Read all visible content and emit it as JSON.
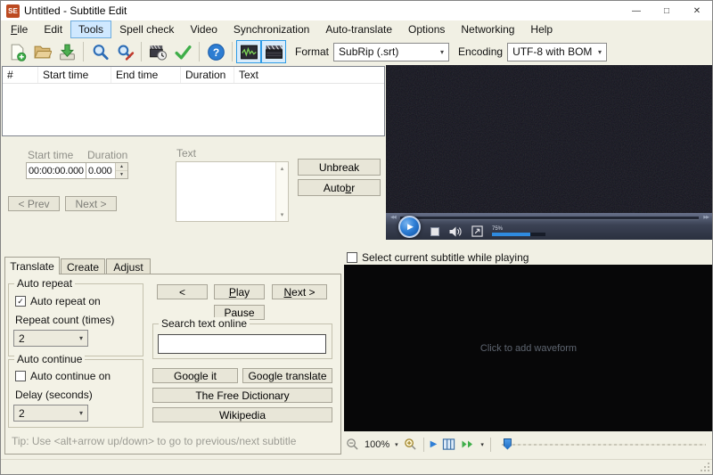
{
  "window": {
    "title": "Untitled - Subtitle Edit",
    "app_badge": "SE",
    "controls": {
      "minimize": "—",
      "maximize": "□",
      "close": "✕"
    }
  },
  "menu": {
    "items": [
      "File",
      "Edit",
      "Tools",
      "Spell check",
      "Video",
      "Synchronization",
      "Auto-translate",
      "Options",
      "Networking",
      "Help"
    ],
    "active_item": "Tools"
  },
  "toolbar": {
    "icons": [
      "new-icon",
      "open-icon",
      "save-icon",
      "find-icon",
      "replace-icon",
      "visual-sync-icon",
      "spell-check-icon",
      "help-icon",
      "waveform-toggle-icon",
      "video-toggle-icon"
    ],
    "format_label": "Format",
    "format_value": "SubRip (.srt)",
    "encoding_label": "Encoding",
    "encoding_value": "UTF-8 with BOM"
  },
  "listview": {
    "columns": [
      "#",
      "Start time",
      "End time",
      "Duration",
      "Text"
    ],
    "rows": []
  },
  "editor": {
    "start_time_label": "Start time",
    "start_time_value": "00:00:00.000",
    "duration_label": "Duration",
    "duration_value": "0.000",
    "text_label": "Text",
    "unbreak_label": "Unbreak",
    "auto_br": {
      "pre": "Auto ",
      "key": "b",
      "post": "r"
    },
    "prev_label": "< Prev",
    "next_label": "Next >"
  },
  "video": {
    "volume": "75%",
    "icons": [
      "rewind-icon",
      "forward-icon",
      "play-button",
      "stop-icon",
      "volume-icon",
      "fullscreen-icon"
    ]
  },
  "bottom": {
    "tabs": [
      "Translate",
      "Create",
      "Adjust"
    ],
    "active_tab": "Translate",
    "auto_repeat": {
      "title": "Auto repeat",
      "checkbox_label": "Auto repeat on",
      "checked": true,
      "count_label": "Repeat count (times)",
      "count_value": "2"
    },
    "auto_continue": {
      "title": "Auto continue",
      "checkbox_label": "Auto continue on",
      "checked": false,
      "delay_label": "Delay (seconds)",
      "delay_value": "2"
    },
    "playback": {
      "back_label": "<",
      "play": {
        "key": "P",
        "post": "lay"
      },
      "next": {
        "key": "N",
        "post": "ext >"
      },
      "pause_label": "Pause"
    },
    "search": {
      "title": "Search text online",
      "buttons": [
        "Google it",
        "Google translate",
        "The Free Dictionary",
        "Wikipedia"
      ]
    },
    "tip": "Tip: Use <alt+arrow up/down> to go to previous/next subtitle"
  },
  "waveform": {
    "select_checkbox_label": "Select current subtitle while playing",
    "select_checked": false,
    "placeholder": "Click to add waveform",
    "zoom_value": "100%",
    "icons": [
      "zoom-out-icon",
      "zoom-in-icon",
      "play-icon",
      "columns-icon",
      "fast-forward-icon",
      "position-slider"
    ]
  },
  "icons": {
    "spin_up": "▲",
    "spin_down": "▼",
    "caret_down": "▾",
    "scroll_up": "▴",
    "scroll_down": "▾",
    "rewind": "◀◀",
    "forward": "▶▶",
    "play": "▶",
    "check": "✓"
  },
  "colors": {
    "accent_blue": "#2f8be0",
    "menu_highlight": "#cfe8ff",
    "toggle_selected_border": "#2e9be6",
    "app_icon_bg": "#bc4a21",
    "volume_fill": "#2f8be0"
  }
}
